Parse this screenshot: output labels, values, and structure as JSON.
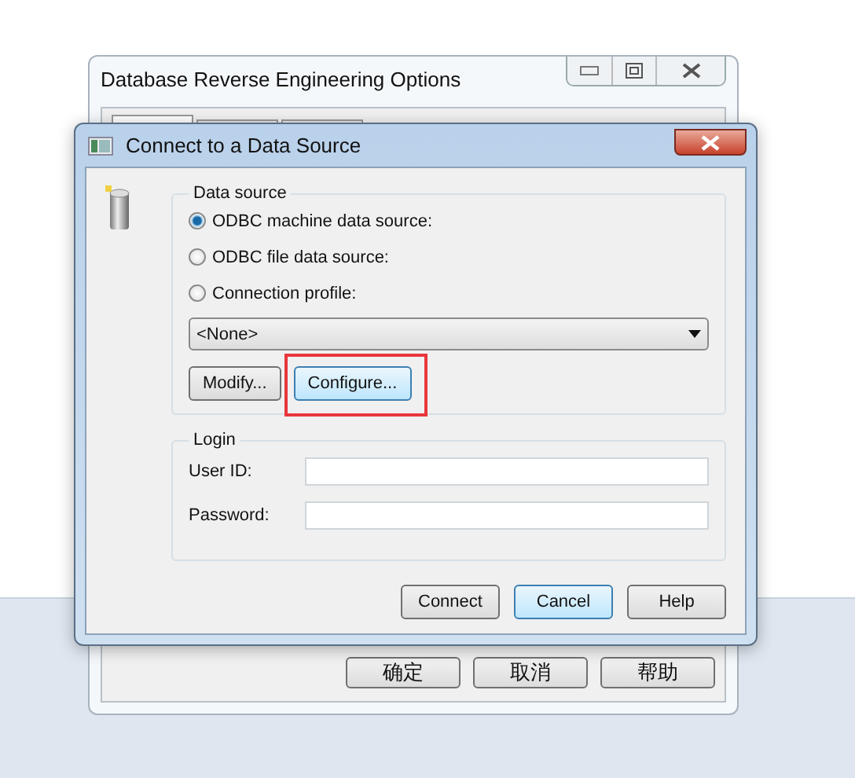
{
  "back_window": {
    "title": "Database Reverse Engineering Options",
    "tabs": [
      {
        "selected": true
      },
      {
        "selected": false
      },
      {
        "selected": false
      }
    ],
    "buttons": [
      "确定",
      "取消",
      "帮助"
    ]
  },
  "dialog": {
    "title": "Connect to a Data Source",
    "data_source": {
      "legend": "Data source",
      "options": [
        {
          "label": "ODBC machine data source:",
          "selected": true
        },
        {
          "label": "ODBC file data source:",
          "selected": false
        },
        {
          "label": "Connection profile:",
          "selected": false
        }
      ],
      "profile_select": {
        "value": "<None>"
      },
      "buttons": [
        {
          "label": "Modify...",
          "highlighted": false
        },
        {
          "label": "Configure...",
          "highlighted": true
        }
      ]
    },
    "login": {
      "legend": "Login",
      "fields": [
        {
          "label": "User ID:"
        },
        {
          "label": "Password:"
        }
      ]
    },
    "buttons": [
      {
        "label": "Connect",
        "default": false
      },
      {
        "label": "Cancel",
        "default": true
      },
      {
        "label": "Help",
        "default": false
      }
    ]
  }
}
